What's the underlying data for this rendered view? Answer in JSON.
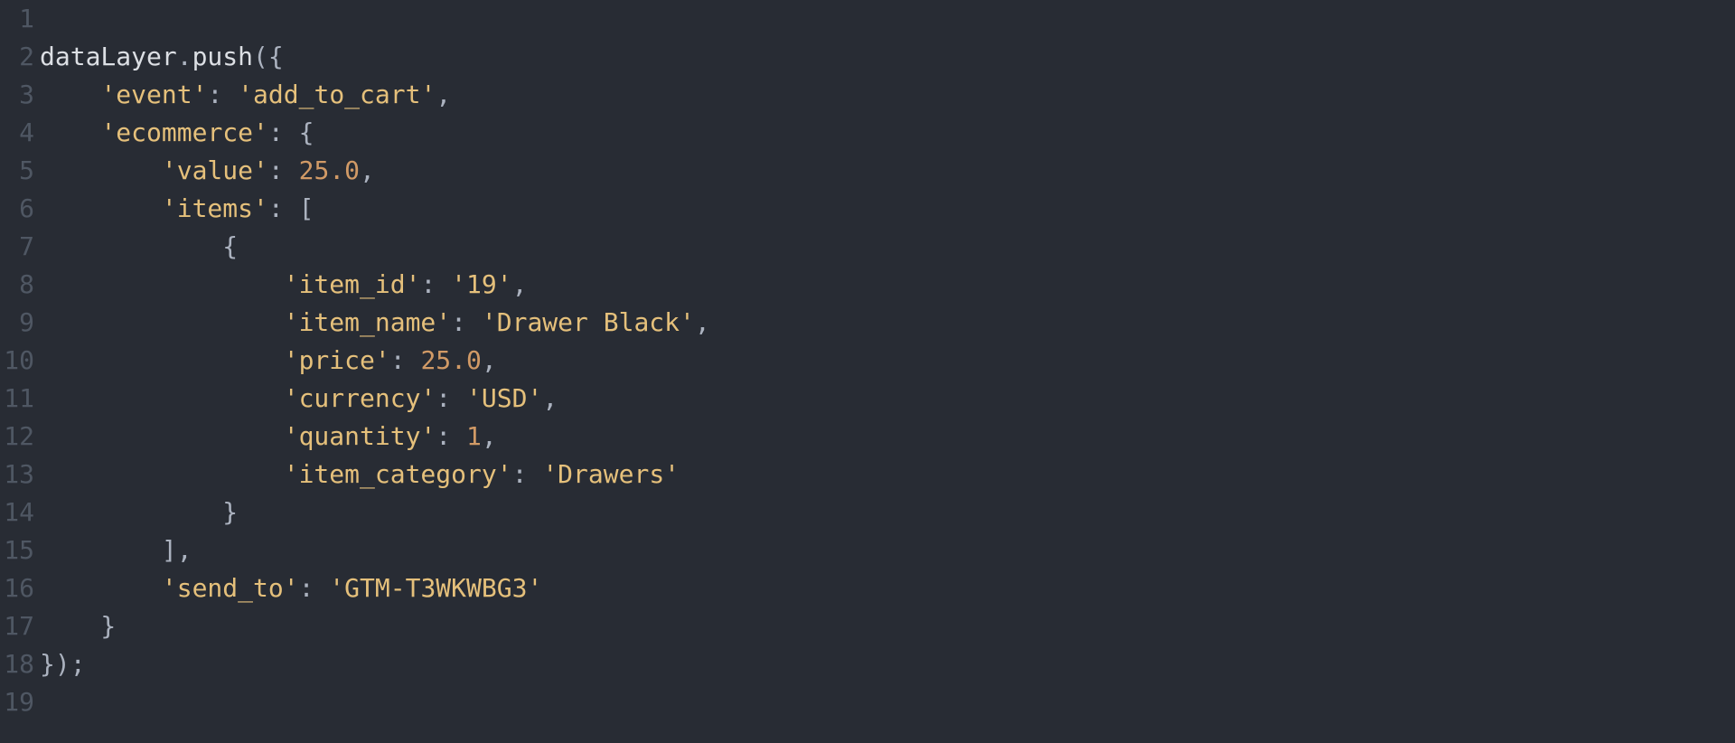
{
  "editor": {
    "line_count": 19,
    "lines": [
      {
        "n": 1,
        "tokens": []
      },
      {
        "n": 2,
        "tokens": [
          {
            "t": "dataLayer",
            "c": "tok-ident"
          },
          {
            "t": ".",
            "c": "tok-punc"
          },
          {
            "t": "push",
            "c": "tok-ident"
          },
          {
            "t": "({",
            "c": "tok-punc"
          }
        ]
      },
      {
        "n": 3,
        "tokens": [
          {
            "t": "    ",
            "c": "tok-default"
          },
          {
            "t": "'event'",
            "c": "tok-string"
          },
          {
            "t": ": ",
            "c": "tok-punc"
          },
          {
            "t": "'add_to_cart'",
            "c": "tok-string"
          },
          {
            "t": ",",
            "c": "tok-punc"
          }
        ]
      },
      {
        "n": 4,
        "tokens": [
          {
            "t": "    ",
            "c": "tok-default"
          },
          {
            "t": "'ecommerce'",
            "c": "tok-string"
          },
          {
            "t": ": {",
            "c": "tok-punc"
          }
        ]
      },
      {
        "n": 5,
        "tokens": [
          {
            "t": "        ",
            "c": "tok-default"
          },
          {
            "t": "'value'",
            "c": "tok-string"
          },
          {
            "t": ": ",
            "c": "tok-punc"
          },
          {
            "t": "25.0",
            "c": "tok-number"
          },
          {
            "t": ",",
            "c": "tok-punc"
          }
        ]
      },
      {
        "n": 6,
        "tokens": [
          {
            "t": "        ",
            "c": "tok-default"
          },
          {
            "t": "'items'",
            "c": "tok-string"
          },
          {
            "t": ": [",
            "c": "tok-punc"
          }
        ]
      },
      {
        "n": 7,
        "tokens": [
          {
            "t": "            {",
            "c": "tok-punc"
          }
        ]
      },
      {
        "n": 8,
        "tokens": [
          {
            "t": "                ",
            "c": "tok-default"
          },
          {
            "t": "'item_id'",
            "c": "tok-string"
          },
          {
            "t": ": ",
            "c": "tok-punc"
          },
          {
            "t": "'19'",
            "c": "tok-string"
          },
          {
            "t": ",",
            "c": "tok-punc"
          }
        ]
      },
      {
        "n": 9,
        "tokens": [
          {
            "t": "                ",
            "c": "tok-default"
          },
          {
            "t": "'item_name'",
            "c": "tok-string"
          },
          {
            "t": ": ",
            "c": "tok-punc"
          },
          {
            "t": "'Drawer Black'",
            "c": "tok-string"
          },
          {
            "t": ",",
            "c": "tok-punc"
          }
        ]
      },
      {
        "n": 10,
        "tokens": [
          {
            "t": "                ",
            "c": "tok-default"
          },
          {
            "t": "'price'",
            "c": "tok-string"
          },
          {
            "t": ": ",
            "c": "tok-punc"
          },
          {
            "t": "25.0",
            "c": "tok-number"
          },
          {
            "t": ",",
            "c": "tok-punc"
          }
        ]
      },
      {
        "n": 11,
        "tokens": [
          {
            "t": "                ",
            "c": "tok-default"
          },
          {
            "t": "'currency'",
            "c": "tok-string"
          },
          {
            "t": ": ",
            "c": "tok-punc"
          },
          {
            "t": "'USD'",
            "c": "tok-string"
          },
          {
            "t": ",",
            "c": "tok-punc"
          }
        ]
      },
      {
        "n": 12,
        "tokens": [
          {
            "t": "                ",
            "c": "tok-default"
          },
          {
            "t": "'quantity'",
            "c": "tok-string"
          },
          {
            "t": ": ",
            "c": "tok-punc"
          },
          {
            "t": "1",
            "c": "tok-number"
          },
          {
            "t": ",",
            "c": "tok-punc"
          }
        ]
      },
      {
        "n": 13,
        "tokens": [
          {
            "t": "                ",
            "c": "tok-default"
          },
          {
            "t": "'item_category'",
            "c": "tok-string"
          },
          {
            "t": ": ",
            "c": "tok-punc"
          },
          {
            "t": "'Drawers'",
            "c": "tok-string"
          }
        ]
      },
      {
        "n": 14,
        "tokens": [
          {
            "t": "            }",
            "c": "tok-punc"
          }
        ]
      },
      {
        "n": 15,
        "tokens": [
          {
            "t": "        ],",
            "c": "tok-punc"
          }
        ]
      },
      {
        "n": 16,
        "tokens": [
          {
            "t": "        ",
            "c": "tok-default"
          },
          {
            "t": "'send_to'",
            "c": "tok-string"
          },
          {
            "t": ": ",
            "c": "tok-punc"
          },
          {
            "t": "'GTM-T3WKWBG3'",
            "c": "tok-string"
          }
        ]
      },
      {
        "n": 17,
        "tokens": [
          {
            "t": "    }",
            "c": "tok-punc"
          }
        ]
      },
      {
        "n": 18,
        "tokens": [
          {
            "t": "});",
            "c": "tok-punc"
          }
        ]
      },
      {
        "n": 19,
        "tokens": []
      }
    ]
  }
}
